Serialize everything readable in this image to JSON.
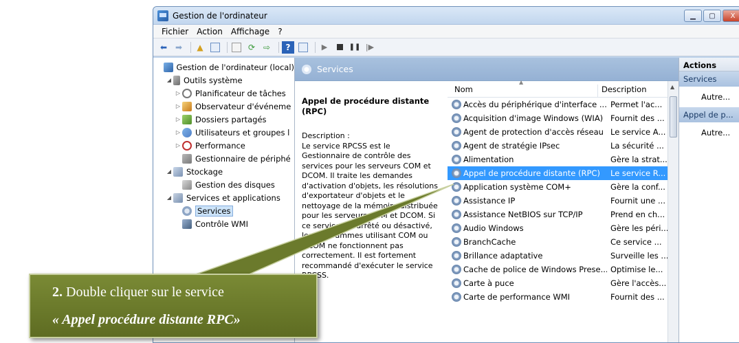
{
  "window": {
    "title": "Gestion de l'ordinateur",
    "min_label": "▭",
    "max_label": "▢",
    "close_label": "X"
  },
  "menu": [
    "Fichier",
    "Action",
    "Affichage",
    "?"
  ],
  "tree": {
    "items": [
      {
        "label": "Gestion de l'ordinateur (local)",
        "icon": "computer-icon",
        "indent": 0,
        "expander": ""
      },
      {
        "label": "Outils système",
        "icon": "tools-icon",
        "indent": 1,
        "expander": "◢"
      },
      {
        "label": "Planificateur de tâches",
        "icon": "clock-icon",
        "indent": 2,
        "expander": "▷"
      },
      {
        "label": "Observateur d'événeme",
        "icon": "event-viewer-icon",
        "indent": 2,
        "expander": "▷"
      },
      {
        "label": "Dossiers partagés",
        "icon": "shared-folder-icon",
        "indent": 2,
        "expander": "▷"
      },
      {
        "label": "Utilisateurs et groupes l",
        "icon": "users-icon",
        "indent": 2,
        "expander": "▷"
      },
      {
        "label": "Performance",
        "icon": "performance-icon",
        "indent": 2,
        "expander": "▷"
      },
      {
        "label": "Gestionnaire de périphé",
        "icon": "device-manager-icon",
        "indent": 2,
        "expander": ""
      },
      {
        "label": "Stockage",
        "icon": "storage-icon",
        "indent": 1,
        "expander": "◢"
      },
      {
        "label": "Gestion des disques",
        "icon": "disk-icon",
        "indent": 2,
        "expander": ""
      },
      {
        "label": "Services et applications",
        "icon": "services-apps-icon",
        "indent": 1,
        "expander": "◢"
      },
      {
        "label": "Services",
        "icon": "gear-icon",
        "indent": 2,
        "expander": "",
        "selected": true
      },
      {
        "label": "Contrôle WMI",
        "icon": "wmi-icon",
        "indent": 2,
        "expander": ""
      }
    ]
  },
  "services_panel": {
    "header": "Services",
    "selected_title": "Appel de procédure distante (RPC)",
    "description_label": "Description :",
    "description_text": "Le service RPCSS est le Gestionnaire de contrôle des services pour les serveurs COM et DCOM. Il traite les demandes d'activation d'objets, les résolutions d'exportateur d'objets et le nettoyage de la mémoire distribuée pour les serveurs COM et DCOM. Si ce service est arrêté ou désactivé, les programmes utilisant COM ou DCOM ne fonctionnent pas correctement. Il est fortement recommandé d'exécuter le service RPCSS."
  },
  "service_list": {
    "col_name": "Nom",
    "col_desc": "Description",
    "rows": [
      {
        "name": "Accès du périphérique d'interface ...",
        "desc": "Permet l'ac..."
      },
      {
        "name": "Acquisition d'image Windows (WIA)",
        "desc": "Fournit des ..."
      },
      {
        "name": "Agent de protection d'accès réseau",
        "desc": "Le service A..."
      },
      {
        "name": "Agent de stratégie IPsec",
        "desc": "La sécurité ..."
      },
      {
        "name": "Alimentation",
        "desc": "Gère la strat..."
      },
      {
        "name": "Appel de procédure distante (RPC)",
        "desc": "Le service R...",
        "selected": true
      },
      {
        "name": "Application système COM+",
        "desc": "Gère la conf..."
      },
      {
        "name": "Assistance IP",
        "desc": "Fournit une ..."
      },
      {
        "name": "Assistance NetBIOS sur TCP/IP",
        "desc": "Prend en ch..."
      },
      {
        "name": "Audio Windows",
        "desc": "Gère les péri..."
      },
      {
        "name": "BranchCache",
        "desc": "Ce service ..."
      },
      {
        "name": "Brillance adaptative",
        "desc": "Surveille les ..."
      },
      {
        "name": "Cache de police de Windows Prese...",
        "desc": "Optimise le..."
      },
      {
        "name": "Carte à puce",
        "desc": "Gère l'accès..."
      },
      {
        "name": "Carte de performance WMI",
        "desc": "Fournit des ..."
      }
    ]
  },
  "actions": {
    "header": "Actions",
    "section1": "Services",
    "item1": "Autre...",
    "section2": "Appel de p...",
    "item2": "Autre..."
  },
  "callout": {
    "number": "2.",
    "line1": "Double cliquer sur le service",
    "line2": "« Appel procédure distante RPC»"
  },
  "colors": {
    "selection": "#3399ff",
    "callout_fill": "#6b7a2c",
    "header_blue": "#9fb9da"
  }
}
